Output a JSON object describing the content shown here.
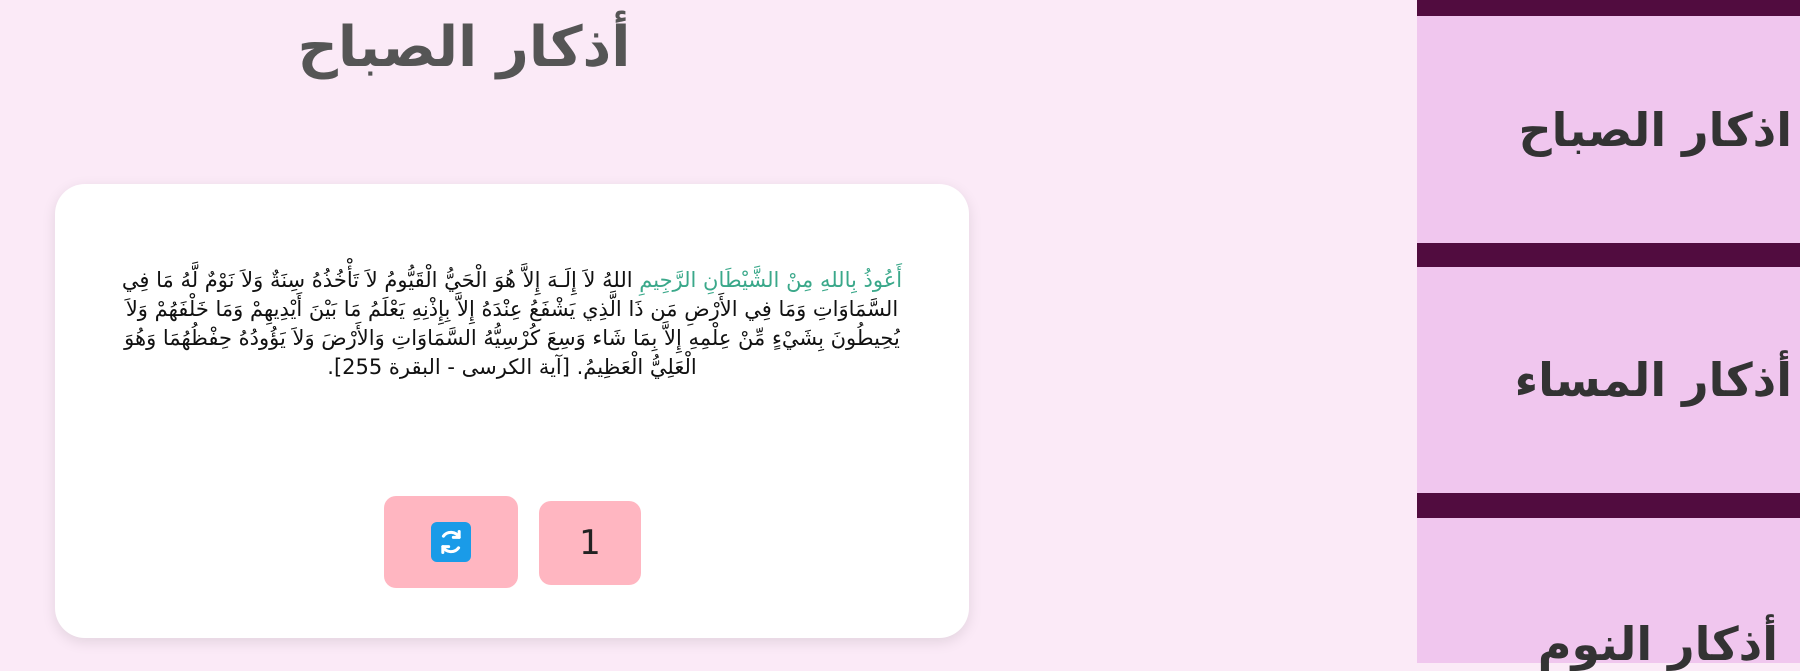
{
  "page": {
    "title": "أذكار الصباح"
  },
  "dhikr": {
    "istiadha": "أَعُوذُ بِاللهِ مِنْ الشَّيْطَانِ الرَّجِيمِ",
    "text": " اللهُ لاَ إِلَـهَ إِلاَّ هُوَ الْحَيُّ الْقَيُّومُ لاَ تَأْخُذُهُ سِنَةٌ وَلاَ نَوْمٌ لَّهُ مَا فِي السَّمَاوَاتِ وَمَا فِي الأَرْضِ مَن ذَا الَّذِي يَشْفَعُ عِنْدَهُ إِلاَّ بِإِذْنِهِ يَعْلَمُ مَا بَيْنَ أَيْدِيهِمْ وَمَا خَلْفَهُمْ وَلاَ يُحِيطُونَ بِشَيْءٍ مِّنْ عِلْمِهِ إِلاَّ بِمَا شَاء وَسِعَ كُرْسِيُّهُ السَّمَاوَاتِ وَالأَرْضَ وَلاَ يَؤُودُهُ حِفْظُهُمَا وَهُوَ الْعَلِيُّ الْعَظِيمُ. [آية الكرسى - البقرة 255]."
  },
  "controls": {
    "counter_value": "1",
    "reset_icon": "refresh-icon"
  },
  "sidebar": {
    "items": [
      {
        "label": "اذكار الصباح"
      },
      {
        "label": "أذكار المساء"
      },
      {
        "label": "أذكار النوم"
      }
    ]
  },
  "colors": {
    "background": "#fbeaf7",
    "sidebar_background": "#510c3f",
    "sidebar_item": "#f0c6ee",
    "button": "#ffb6c1",
    "accent_text": "#3aa88a",
    "icon": "#1a9be8"
  }
}
